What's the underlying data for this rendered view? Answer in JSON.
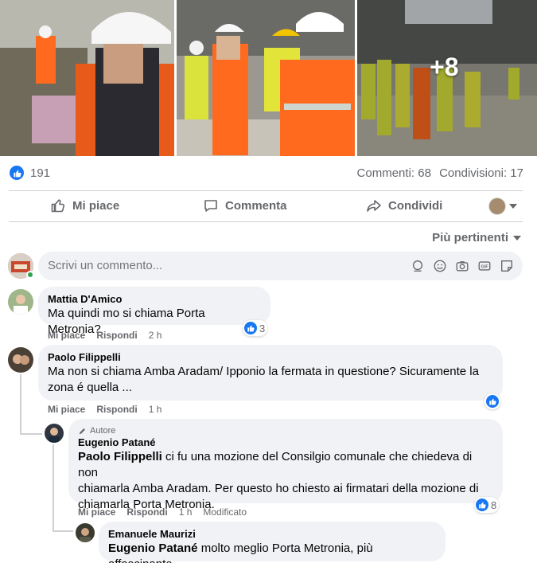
{
  "post": {
    "more_photos": "+8",
    "like_count": "191",
    "comments_count": "Commenti: 68",
    "shares_count": "Condivisioni: 17"
  },
  "actions": {
    "like": "Mi piace",
    "comment": "Commenta",
    "share": "Condividi"
  },
  "sort_label": "Più pertinenti",
  "composer": {
    "placeholder": "Scrivi un commento..."
  },
  "comments": [
    {
      "author": "Mattia D'Amico",
      "text": "Ma quindi mo si chiama Porta Metronia?",
      "like_label": "Mi piace",
      "reply_label": "Rispondi",
      "time": "2 h",
      "reactions": "3"
    },
    {
      "author": "Paolo Filippelli",
      "text_line1": "Ma non si chiama Amba Aradam/ Ipponio la fermata in questione? Sicuramente la",
      "text_line2": "zona é quella ...",
      "like_label": "Mi piace",
      "reply_label": "Rispondi",
      "time": "1 h",
      "reactions": ""
    }
  ],
  "replies": [
    {
      "badge": "Autore",
      "author": "Eugenio Patané",
      "mention": "Paolo Filippelli",
      "text_line1": " ci fu una mozione del Consilgio comunale che chiedeva di non",
      "text_line2": "chiamarla Amba Aradam. Per questo ho chiesto ai firmatari della mozione di",
      "text_line3": "chiamarla Porta Metronia.",
      "like_label": "Mi piace",
      "reply_label": "Rispondi",
      "time": "1 h",
      "edited": "Modificato",
      "reactions": "8"
    },
    {
      "author": "Emanuele Maurizi",
      "mention": "Eugenio Patané",
      "text": " molto meglio Porta Metronia, più affascinante"
    }
  ],
  "colors": {
    "accent": "#1877f2",
    "muted_text": "#65676b",
    "bubble": "#f0f2f5"
  }
}
